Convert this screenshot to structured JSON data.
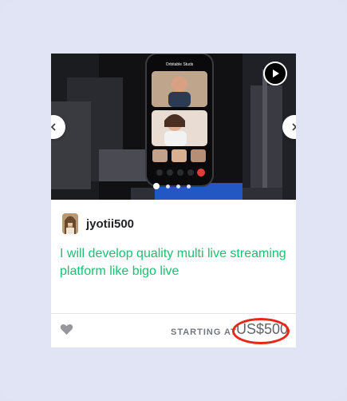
{
  "gig": {
    "seller_name": "jyotii500",
    "title": "I will develop quality multi live streaming platform like bigo live",
    "starting_label": "STARTING AT",
    "price": "US$500",
    "phone_header": "Orbitable Studs"
  },
  "gallery": {
    "slides_count": 4,
    "active_index": 0
  },
  "colors": {
    "title": "#1dbf73",
    "highlight_ring": "#e8271b",
    "page_bg": "#e0e4f4"
  },
  "icons": [
    "play-icon",
    "chevron-left-icon",
    "chevron-right-icon",
    "heart-icon"
  ]
}
